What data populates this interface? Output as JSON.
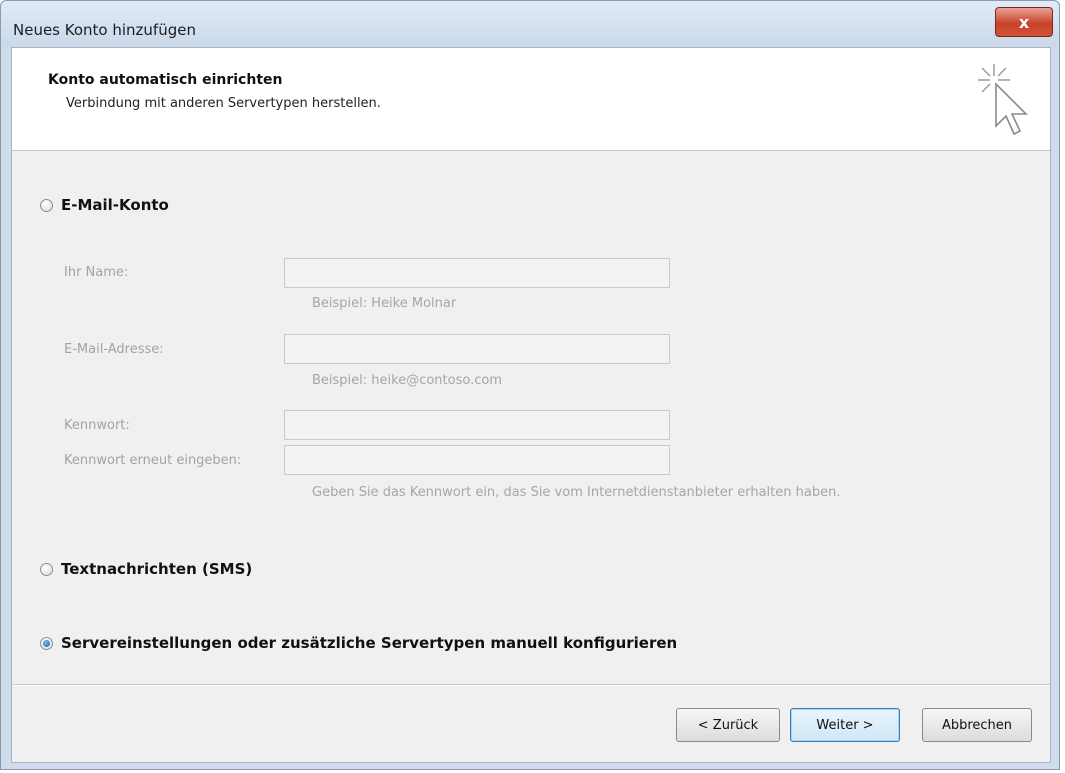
{
  "window": {
    "title": "Neues Konto hinzufügen",
    "close_label": "x"
  },
  "header": {
    "title": "Konto automatisch einrichten",
    "subtitle": "Verbindung mit anderen Servertypen herstellen.",
    "icon": "sparkle-cursor-icon"
  },
  "options": {
    "email": {
      "label": "E-Mail-Konto",
      "selected": false
    },
    "sms": {
      "label": "Textnachrichten (SMS)",
      "selected": false
    },
    "manual": {
      "label": "Servereinstellungen oder zusätzliche Servertypen manuell konfigurieren",
      "selected": true
    }
  },
  "form": {
    "name": {
      "label": "Ihr Name:",
      "value": "",
      "hint": "Beispiel: Heike Molnar"
    },
    "email": {
      "label": "E-Mail-Adresse:",
      "value": "",
      "hint": "Beispiel: heike@contoso.com"
    },
    "password": {
      "label": "Kennwort:",
      "value": ""
    },
    "password_repeat": {
      "label": "Kennwort erneut eingeben:",
      "value": ""
    },
    "password_hint": "Geben Sie das Kennwort ein, das Sie vom Internetdienstanbieter erhalten haben."
  },
  "buttons": {
    "back": "< Zurück",
    "next": "Weiter >",
    "cancel": "Abbrechen"
  },
  "colors": {
    "titlebar": "#cfdceb",
    "close_button": "#c8422a",
    "disabled_text": "#a3a3a3",
    "radio_selected": "#1f5ea8"
  }
}
